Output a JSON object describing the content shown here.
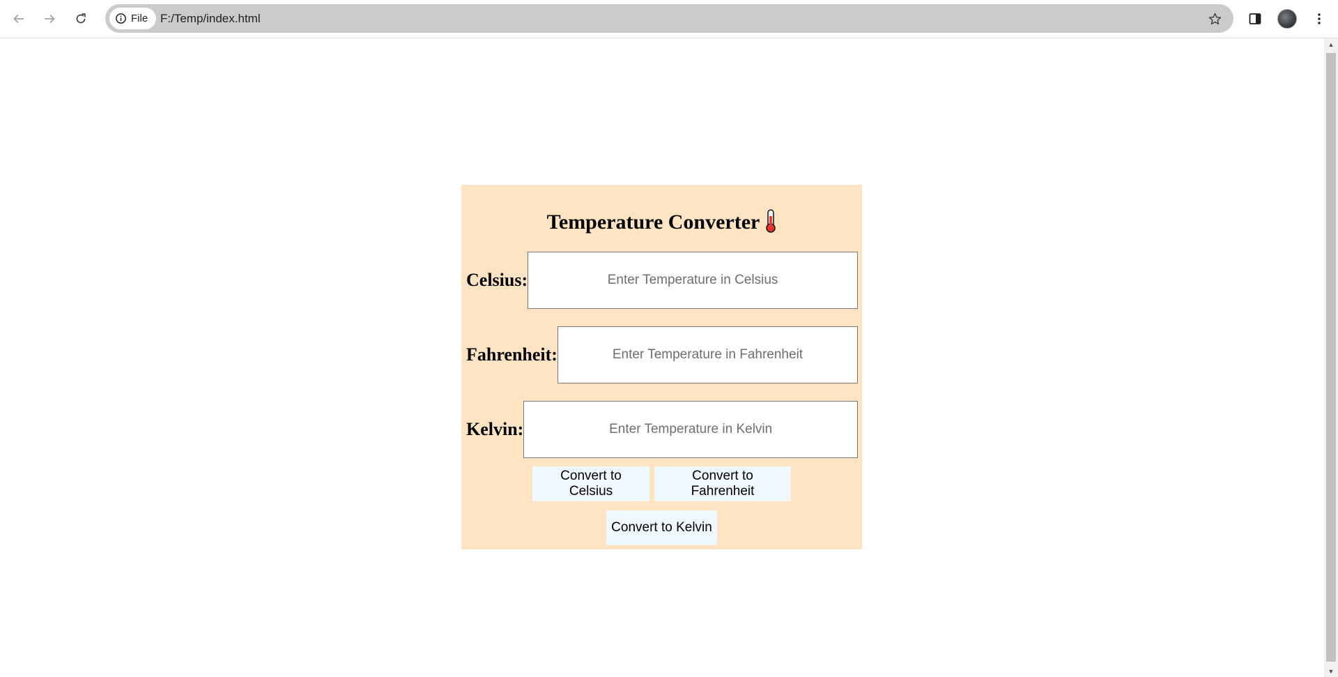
{
  "browser": {
    "back_icon": "arrow-left-icon",
    "forward_icon": "arrow-right-icon",
    "reload_icon": "reload-icon",
    "site_info_label": "File",
    "url": "F:/Temp/index.html",
    "bookmark_icon": "star-icon",
    "side_panel_icon": "side-panel-icon",
    "menu_icon": "kebab-menu-icon"
  },
  "converter": {
    "title": "Temperature Converter",
    "title_emoji": "thermometer-icon",
    "background": "#ffe4c4",
    "button_background": "#f0f8ff",
    "fields": [
      {
        "label": "Celsius:",
        "value": "",
        "placeholder": "Enter Temperature in Celsius"
      },
      {
        "label": "Fahrenheit:",
        "value": "",
        "placeholder": "Enter Temperature in Fahrenheit"
      },
      {
        "label": "Kelvin:",
        "value": "",
        "placeholder": "Enter Temperature in Kelvin"
      }
    ],
    "buttons": {
      "to_celsius": "Convert to Celsius",
      "to_fahrenheit": "Convert to Fahrenheit",
      "to_kelvin": "Convert to Kelvin"
    }
  }
}
